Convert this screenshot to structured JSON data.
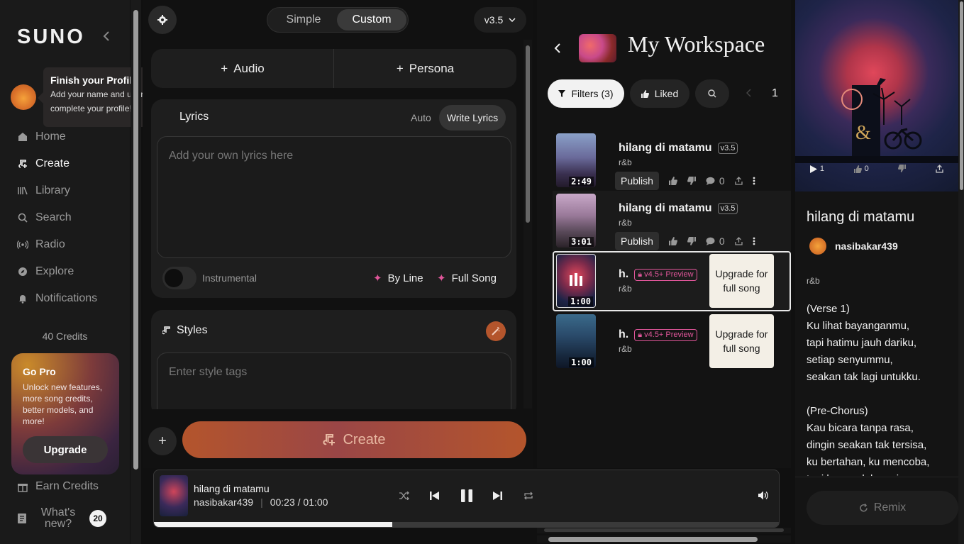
{
  "sidebar": {
    "logo": "SUNO",
    "tooltip": {
      "title": "Finish your Profile",
      "desc": "Add your name and user name to complete your profile!",
      "close": "×"
    },
    "nav": [
      {
        "label": "Home",
        "icon": "home-icon"
      },
      {
        "label": "Create",
        "icon": "music-note-icon"
      },
      {
        "label": "Library",
        "icon": "library-icon"
      },
      {
        "label": "Search",
        "icon": "search-icon"
      },
      {
        "label": "Radio",
        "icon": "radio-icon"
      },
      {
        "label": "Explore",
        "icon": "compass-icon"
      },
      {
        "label": "Notifications",
        "icon": "bell-icon"
      }
    ],
    "credits": "40 Credits",
    "gopro": {
      "title": "Go Pro",
      "desc": "Unlock new features, more song credits, better models, and more!",
      "button": "Upgrade"
    },
    "earn": "Earn Credits",
    "whats_new": "What's new?",
    "whats_new_count": "20"
  },
  "create": {
    "mode_simple": "Simple",
    "mode_custom": "Custom",
    "version": "v3.5",
    "audio": "Audio",
    "persona": "Persona",
    "lyrics_title": "Lyrics",
    "lyrics_auto": "Auto",
    "lyrics_write": "Write Lyrics",
    "lyrics_placeholder": "Add your own lyrics here",
    "instrumental": "Instrumental",
    "by_line": "By Line",
    "full_song": "Full Song",
    "styles_title": "Styles",
    "styles_placeholder": "Enter style tags",
    "create_button": "Create"
  },
  "workspace": {
    "title": "My Workspace",
    "filters": "Filters (3)",
    "liked": "Liked",
    "page": "1",
    "songs": [
      {
        "name": "hilang di matamu",
        "version": "v3.5",
        "genre": "r&b",
        "duration": "2:49",
        "publish": "Publish",
        "comments": "0"
      },
      {
        "name": "hilang di matamu",
        "version": "v3.5",
        "genre": "r&b",
        "duration": "3:01",
        "publish": "Publish",
        "comments": "0"
      },
      {
        "name": "h.",
        "version": "v4.5+ Preview",
        "genre": "r&b",
        "duration": "1:00",
        "upgrade": "Upgrade for full song"
      },
      {
        "name": "h.",
        "version": "v4.5+ Preview",
        "genre": "r&b",
        "duration": "1:00",
        "upgrade": "Upgrade for full song"
      }
    ]
  },
  "detail": {
    "plays": "1",
    "likes": "0",
    "title": "hilang di matamu",
    "user": "nasibakar439",
    "genre": "r&b",
    "lyrics": "(Verse 1)\nKu lihat bayanganmu,\ntapi hatimu jauh dariku,\nsetiap senyummu,\nseakan tak lagi untukku.\n\n(Pre-Chorus)\nKau bicara tanpa rasa,\ndingin seakan tak tersisa,\nku bertahan, ku mencoba,\ntapi kau perlahan sirna.",
    "remix": "Remix"
  },
  "player": {
    "title": "hilang di matamu",
    "user": "nasibakar439",
    "current": "00:23 /",
    "total": "01:00",
    "progress": 0.38
  }
}
